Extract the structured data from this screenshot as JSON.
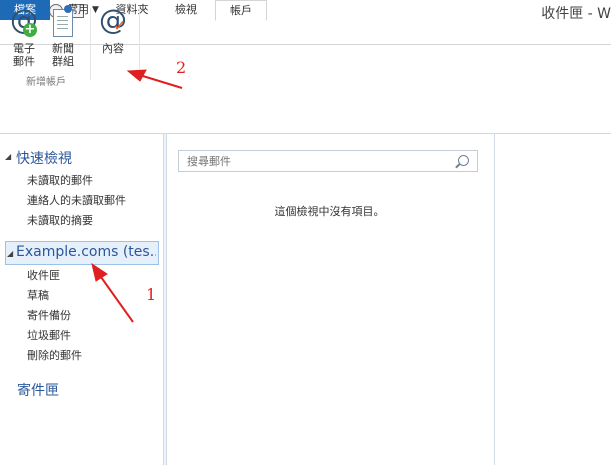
{
  "window": {
    "title": "收件匣 - W"
  },
  "ribbon_tabs": [
    "檔案",
    "常用",
    "資料夾",
    "檢視",
    "帳戶"
  ],
  "ribbon": {
    "buttons": [
      {
        "line1": "電子",
        "line2": "郵件"
      },
      {
        "line1": "新聞",
        "line2": "群組"
      },
      {
        "line1": "內容",
        "line2": ""
      }
    ],
    "group_label": "新增帳戶"
  },
  "nav": {
    "quick_view": {
      "title": "快速檢視",
      "items": [
        "未讀取的郵件",
        "連絡人的未讀取郵件",
        "未讀取的摘要"
      ]
    },
    "account": {
      "title": "Example.coms (tes...",
      "folders": [
        "收件匣",
        "草稿",
        "寄件備份",
        "垃圾郵件",
        "刪除的郵件"
      ]
    },
    "outbox": "寄件匣"
  },
  "message_list": {
    "search_placeholder": "搜尋郵件",
    "empty_text": "這個檢視中沒有項目。"
  },
  "annotations": {
    "label1": "1",
    "label2": "2",
    "color": "#e02020"
  }
}
